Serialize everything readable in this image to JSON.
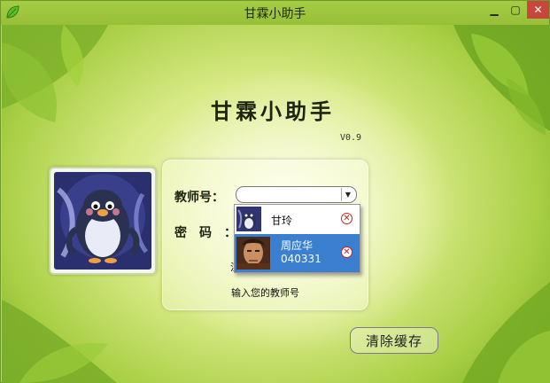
{
  "window": {
    "title": "甘霖小助手",
    "minimize": "▁",
    "maximize": "▢",
    "close": "✕"
  },
  "app": {
    "title": "甘霖小助手",
    "version": "V0.9"
  },
  "login": {
    "teacher_id_label": "教师号：",
    "password_label": "密码：",
    "teacher_id_value": "",
    "hint": "输入您的教师号",
    "partial_text": "注"
  },
  "dropdown": {
    "items": [
      {
        "name": "甘玲",
        "id": ""
      },
      {
        "name": "周应华",
        "id": "040331"
      }
    ]
  },
  "buttons": {
    "clear_cache": "清除缓存"
  }
}
